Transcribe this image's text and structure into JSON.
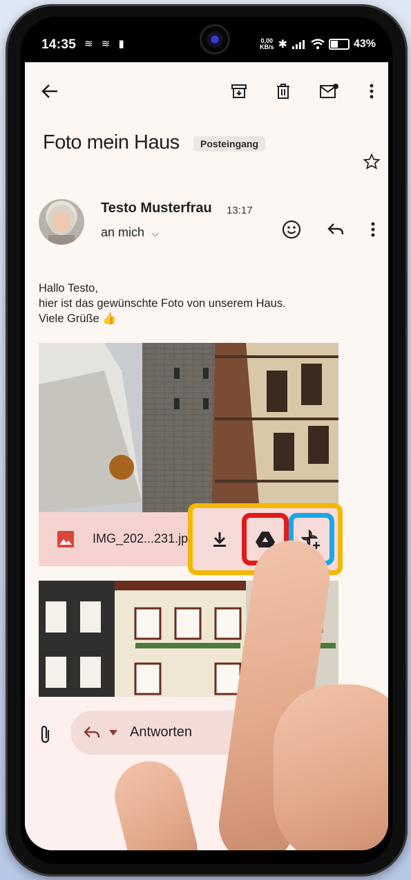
{
  "status_bar": {
    "time": "14:35",
    "left_icons": "≋ ≋ ▮",
    "net_speed": "0,00",
    "net_unit": "KB/s",
    "battery": "43%"
  },
  "toolbar": {
    "back_icon": "arrow-left-icon",
    "archive_icon": "archive-icon",
    "delete_icon": "trash-icon",
    "unread_icon": "mail-unread-icon",
    "more_icon": "more-vert-icon"
  },
  "email": {
    "subject": "Foto mein Haus",
    "label": "Posteingang",
    "sender": "Testo Musterfrau",
    "time": "13:17",
    "recipient": "an mich",
    "body_lines": [
      "Hallo Testo,",
      "hier ist das gewünschte Foto von unserem Haus.",
      "Viele Grüße 👍"
    ]
  },
  "attachment": {
    "filename": "IMG_202...231.jpg",
    "actions": [
      "download-icon",
      "google-drive-icon",
      "add-to-photos-icon"
    ]
  },
  "composer": {
    "reply_label": "Antworten"
  },
  "colors": {
    "screen_bg": "#fdf7f4",
    "attachment_bg": "#f6d3d0",
    "image_icon": "#d9473b",
    "highlight_orange": "#f5b700",
    "highlight_red": "#e11a1a",
    "highlight_blue": "#1aa7e8"
  }
}
